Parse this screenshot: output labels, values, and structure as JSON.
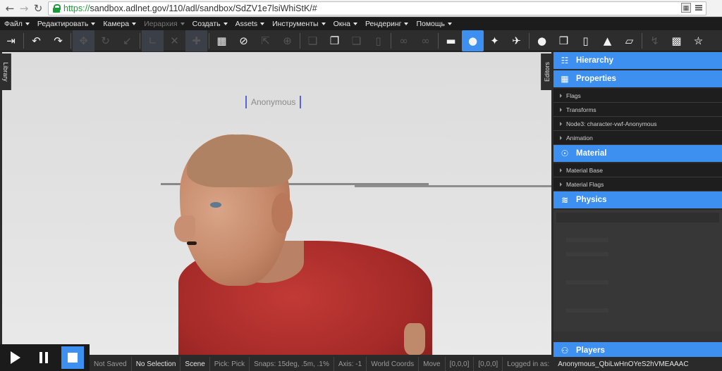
{
  "browser": {
    "url_scheme": "https://",
    "url_rest": "sandbox.adlnet.gov/110/adl/sandbox/SdZV1e7lsiWhiStK/#"
  },
  "menu": [
    {
      "label": "Файл",
      "disabled": false
    },
    {
      "label": "Редактировать",
      "disabled": false
    },
    {
      "label": "Камера",
      "disabled": false
    },
    {
      "label": "Иерархия",
      "disabled": true
    },
    {
      "label": "Создать",
      "disabled": false
    },
    {
      "label": "Assets",
      "disabled": false
    },
    {
      "label": "Инструменты",
      "disabled": false
    },
    {
      "label": "Окна",
      "disabled": false
    },
    {
      "label": "Рендеринг",
      "disabled": false
    },
    {
      "label": "Помощь",
      "disabled": false
    }
  ],
  "toolbar": {
    "accent": "#3d8ff0"
  },
  "tabs": {
    "library": "Library",
    "editors": "Editors"
  },
  "viewport": {
    "name_label": "Anonymous"
  },
  "panel": {
    "hierarchy": "Hierarchy",
    "properties": "Properties",
    "properties_rows": [
      "Flags",
      "Transforms",
      "Node3: character-vwf-Anonymous",
      "Animation"
    ],
    "material": "Material",
    "material_rows": [
      "Material Base",
      "Material Flags"
    ],
    "physics": "Physics",
    "players": "Players"
  },
  "status": {
    "saved": "Not Saved",
    "selection": "No Selection",
    "scene": "Scene",
    "pick": "Pick: Pick",
    "snaps": "Snaps: 15deg, .5m, .1%",
    "axis": "Axis: -1",
    "coords": "World Coords",
    "mode": "Move",
    "pos1": "[0,0,0]",
    "pos2": "[0,0,0]",
    "logged_label": "Logged in as:",
    "user": "Anonymous_QbiLwHnOYeS2hVMEAAAC"
  }
}
